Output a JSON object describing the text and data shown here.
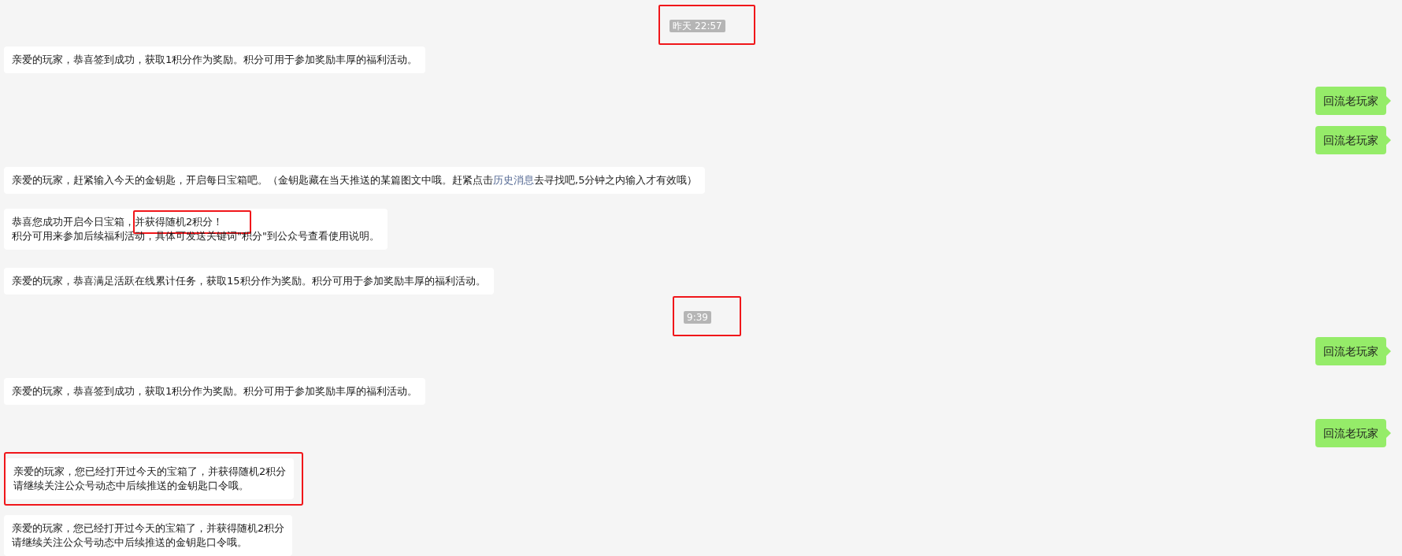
{
  "messages": [
    {
      "kind": "time",
      "text": "昨天 22:57",
      "highlighted": true
    },
    {
      "kind": "received",
      "highlighted": false,
      "lines": [
        [
          {
            "text": "亲爱的玩家，恭喜签到成功，获取1积分作为奖励。积分可用于参加奖励丰厚的福利活动。",
            "kind": "plain"
          }
        ]
      ]
    },
    {
      "kind": "sent",
      "text": "回流老玩家"
    },
    {
      "kind": "sent",
      "text": "回流老玩家"
    },
    {
      "kind": "received",
      "highlighted": false,
      "lines": [
        [
          {
            "text": "亲爱的玩家，赶紧输入今天的金钥匙，开启每日宝箱吧。（金钥匙藏在当天推送的某篇图文中哦。赶紧点击",
            "kind": "plain"
          },
          {
            "text": "历史消息",
            "kind": "link"
          },
          {
            "text": "去寻找吧,5分钟之内输入才有效哦）",
            "kind": "plain"
          }
        ]
      ]
    },
    {
      "kind": "received",
      "highlighted": false,
      "lines": [
        [
          {
            "text": "恭喜您成功开启今日宝箱，",
            "kind": "plain"
          },
          {
            "text": "并获得随机2积分！",
            "kind": "marked"
          }
        ],
        [
          {
            "text": "积分可用来参加后续福利活动，具体可发送关键词\"积分\"到公众号查看使用说明。",
            "kind": "plain"
          }
        ]
      ]
    },
    {
      "kind": "received",
      "highlighted": false,
      "lines": [
        [
          {
            "text": "亲爱的玩家，恭喜满足活跃在线累计任务，获取15积分作为奖励。积分可用于参加奖励丰厚的福利活动。",
            "kind": "plain"
          }
        ]
      ]
    },
    {
      "kind": "time",
      "text": "9:39",
      "highlighted": true
    },
    {
      "kind": "sent",
      "text": "回流老玩家"
    },
    {
      "kind": "received",
      "highlighted": false,
      "lines": [
        [
          {
            "text": "亲爱的玩家，恭喜签到成功，获取1积分作为奖励。积分可用于参加奖励丰厚的福利活动。",
            "kind": "plain"
          }
        ]
      ]
    },
    {
      "kind": "sent",
      "text": "回流老玩家"
    },
    {
      "kind": "received",
      "highlighted": true,
      "lines": [
        [
          {
            "text": "亲爱的玩家，您已经打开过今天的宝箱了，并获得随机2积分",
            "kind": "plain"
          }
        ],
        [
          {
            "text": "请继续关注公众号动态中后续推送的金钥匙口令哦。",
            "kind": "plain"
          }
        ]
      ]
    },
    {
      "kind": "received",
      "highlighted": false,
      "lines": [
        [
          {
            "text": "亲爱的玩家，您已经打开过今天的宝箱了，并获得随机2积分",
            "kind": "plain"
          }
        ],
        [
          {
            "text": "请继续关注公众号动态中后续推送的金钥匙口令哦。",
            "kind": "plain"
          }
        ]
      ]
    }
  ]
}
